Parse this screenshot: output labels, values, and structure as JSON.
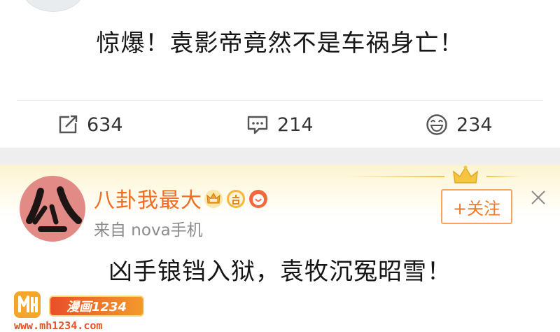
{
  "post1": {
    "text": "惊爆！袁影帝竟然不是车祸身亡！",
    "actions": [
      {
        "icon": "share-icon",
        "count": "634"
      },
      {
        "icon": "comment-icon",
        "count": "214"
      },
      {
        "icon": "like-smile-icon",
        "count": "234"
      }
    ]
  },
  "post2": {
    "username": "八卦我最大",
    "badges": [
      "crown-vip-icon",
      "answer-badge-icon",
      "fan-badge-icon"
    ],
    "source": "来自 nova手机",
    "follow_label": "+关注",
    "text": "凶手锒铛入狱，袁牧沉冤昭雪！"
  },
  "watermark": {
    "logo_text": "漫画1234",
    "url": "www.mh1234.com"
  },
  "colors": {
    "username": "#f06d22",
    "follow_border": "#f3a664",
    "gap": "#eeeeee",
    "avatar_bg": "#e28a86"
  }
}
